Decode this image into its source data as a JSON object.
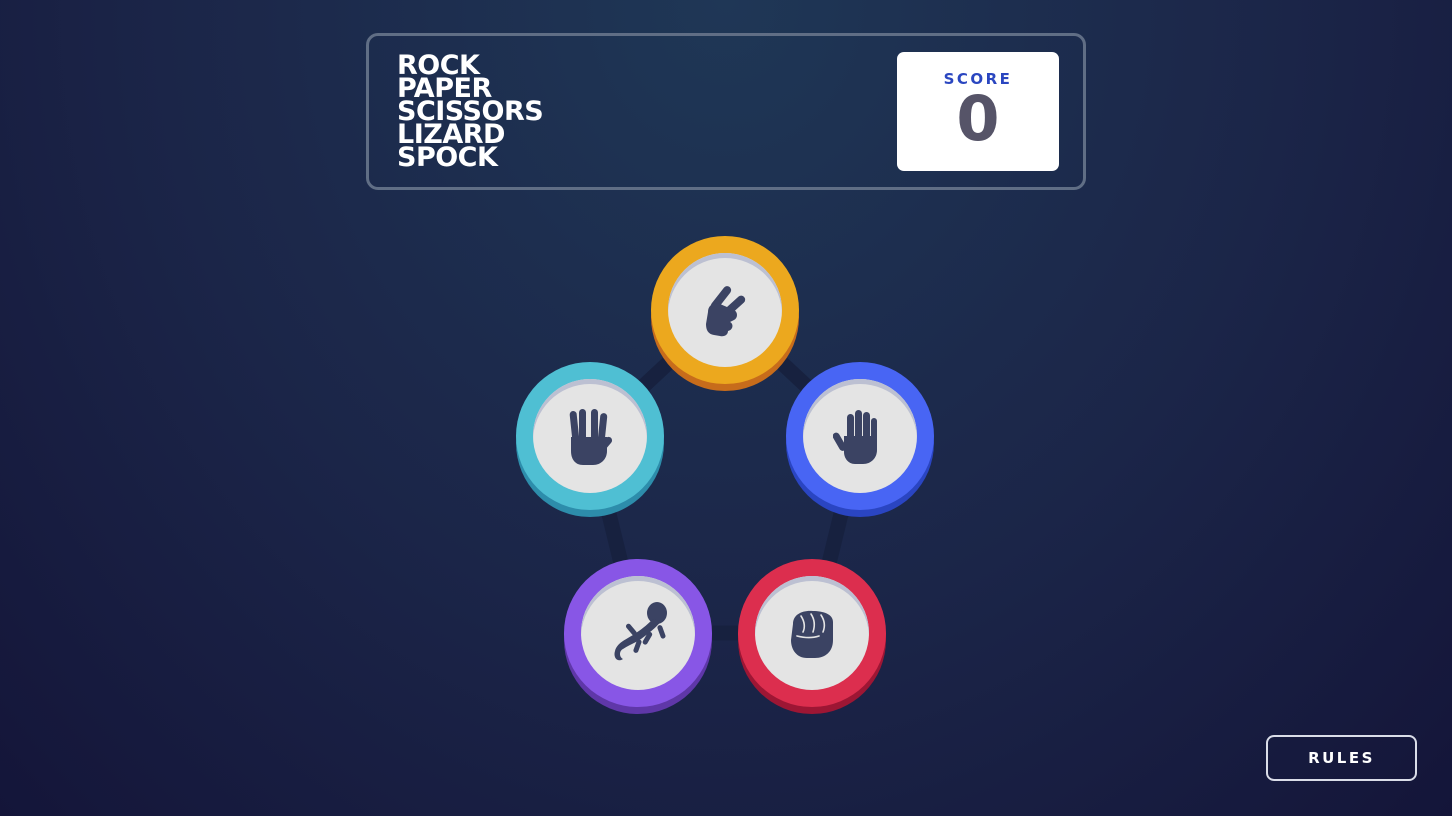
{
  "header": {
    "title_lines": [
      "ROCK",
      "PAPER",
      "SCISSORS",
      "LIZARD",
      "SPOCK"
    ],
    "score_label": "SCORE",
    "score_value": "0"
  },
  "choices": [
    {
      "id": "scissors",
      "icon": "scissors-hand-icon",
      "ring_color": "#eca81e"
    },
    {
      "id": "paper",
      "icon": "paper-hand-icon",
      "ring_color": "#4865f4"
    },
    {
      "id": "rock",
      "icon": "rock-fist-icon",
      "ring_color": "#dc2e4e"
    },
    {
      "id": "lizard",
      "icon": "lizard-icon",
      "ring_color": "#8856e6"
    },
    {
      "id": "spock",
      "icon": "spock-hand-icon",
      "ring_color": "#4fbfd3"
    }
  ],
  "colors": {
    "icon": "#3b4363",
    "background_top": "#1f3756",
    "background_bottom": "#141539"
  },
  "footer": {
    "rules_label": "RULES"
  }
}
